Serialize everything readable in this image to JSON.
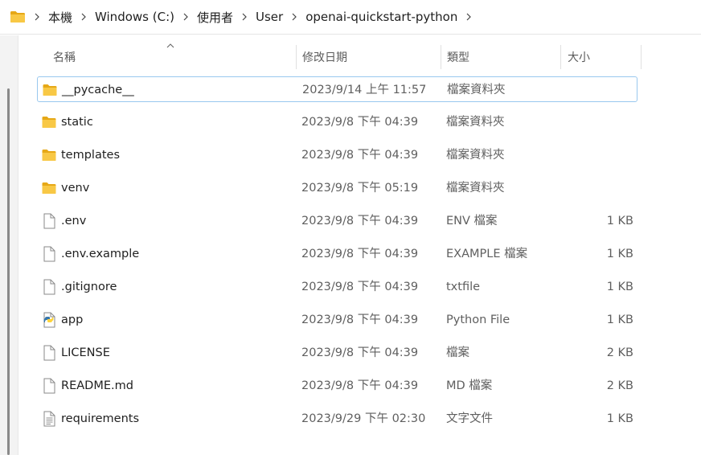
{
  "breadcrumb": [
    "本機",
    "Windows (C:)",
    "使用者",
    "User",
    "openai-quickstart-python"
  ],
  "columns": {
    "name": "名稱",
    "date": "修改日期",
    "type": "類型",
    "size": "大小"
  },
  "files": [
    {
      "name": "__pycache__",
      "date": "2023/9/14 上午 11:57",
      "type": "檔案資料夾",
      "size": "",
      "icon": "folder-icon"
    },
    {
      "name": "static",
      "date": "2023/9/8 下午 04:39",
      "type": "檔案資料夾",
      "size": "",
      "icon": "folder-icon"
    },
    {
      "name": "templates",
      "date": "2023/9/8 下午 04:39",
      "type": "檔案資料夾",
      "size": "",
      "icon": "folder-icon"
    },
    {
      "name": "venv",
      "date": "2023/9/8 下午 05:19",
      "type": "檔案資料夾",
      "size": "",
      "icon": "folder-icon"
    },
    {
      "name": ".env",
      "date": "2023/9/8 下午 04:39",
      "type": "ENV 檔案",
      "size": "1 KB",
      "icon": "file-icon"
    },
    {
      "name": ".env.example",
      "date": "2023/9/8 下午 04:39",
      "type": "EXAMPLE 檔案",
      "size": "1 KB",
      "icon": "file-icon"
    },
    {
      "name": ".gitignore",
      "date": "2023/9/8 下午 04:39",
      "type": "txtfile",
      "size": "1 KB",
      "icon": "file-icon"
    },
    {
      "name": "app",
      "date": "2023/9/8 下午 04:39",
      "type": "Python File",
      "size": "1 KB",
      "icon": "python-file-icon"
    },
    {
      "name": "LICENSE",
      "date": "2023/9/8 下午 04:39",
      "type": "檔案",
      "size": "2 KB",
      "icon": "file-icon"
    },
    {
      "name": "README.md",
      "date": "2023/9/8 下午 04:39",
      "type": "MD 檔案",
      "size": "2 KB",
      "icon": "file-icon"
    },
    {
      "name": "requirements",
      "date": "2023/9/29 下午 02:30",
      "type": "文字文件",
      "size": "1 KB",
      "icon": "text-file-icon"
    }
  ],
  "colors": {
    "folder": "#f8c845",
    "selection_border": "#99c8ef",
    "scrollbar": "#8a8a8a"
  }
}
